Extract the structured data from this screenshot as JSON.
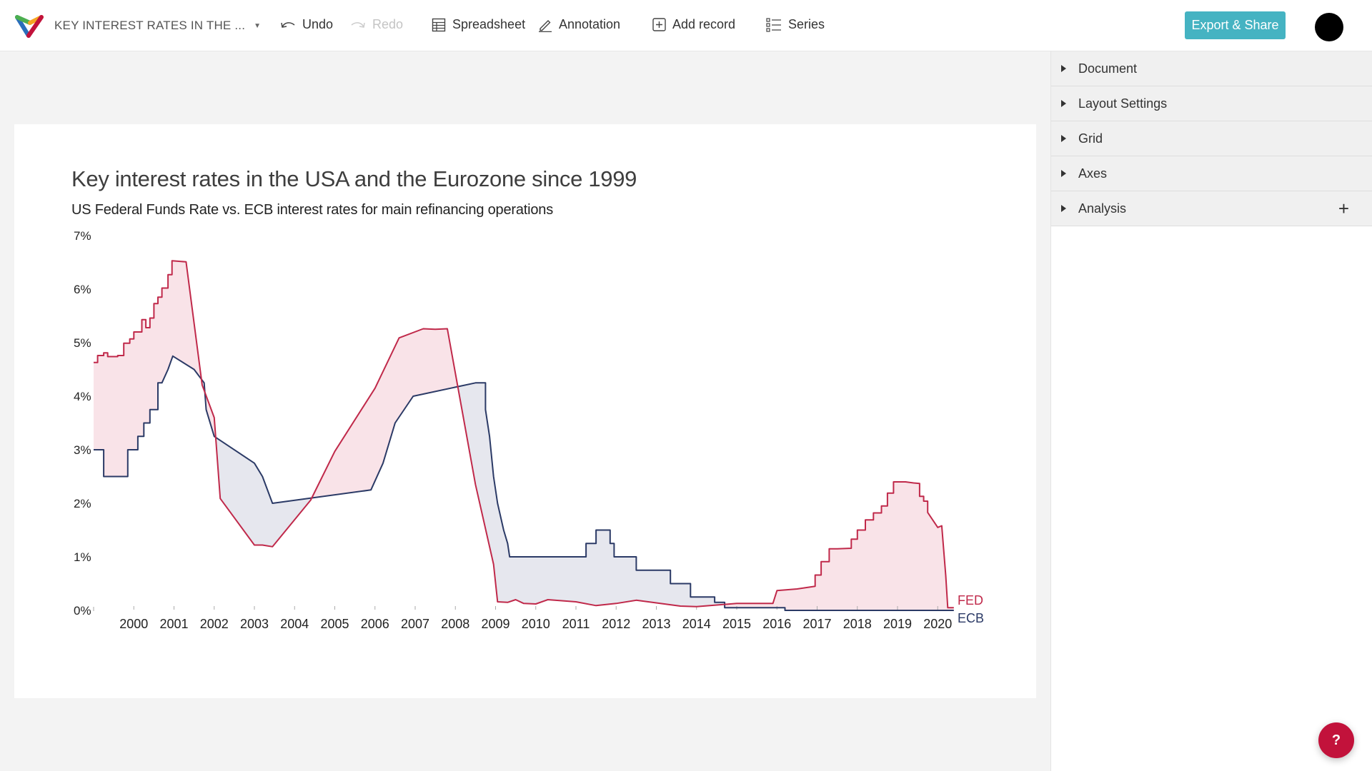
{
  "app": {
    "doc_title": "KEY INTEREST RATES IN THE ...",
    "toolbar": {
      "undo": "Undo",
      "redo": "Redo",
      "spreadsheet": "Spreadsheet",
      "annotation": "Annotation",
      "add_record": "Add record",
      "series": "Series",
      "export": "Export & Share"
    },
    "brand_color": "#45b3c2",
    "help_label": "?"
  },
  "sidebar": {
    "panels": [
      {
        "label": "Document"
      },
      {
        "label": "Layout Settings"
      },
      {
        "label": "Grid"
      },
      {
        "label": "Axes"
      },
      {
        "label": "Analysis",
        "has_add": true
      }
    ],
    "add_symbol": "+"
  },
  "chart_data": {
    "type": "area",
    "title": "Key interest rates in the USA and the Eurozone since 1999",
    "subtitle": "US Federal Funds Rate vs. ECB interest rates for main refinancing operations",
    "xlabel": "",
    "ylabel": "",
    "xlim": [
      1999,
      2020.4
    ],
    "ylim": [
      0,
      7
    ],
    "x_ticks": [
      "2000",
      "2001",
      "2002",
      "2003",
      "2004",
      "2005",
      "2006",
      "2007",
      "2008",
      "2009",
      "2010",
      "2011",
      "2012",
      "2013",
      "2014",
      "2015",
      "2016",
      "2017",
      "2018",
      "2019",
      "2020"
    ],
    "y_ticks": [
      "0%",
      "1%",
      "2%",
      "3%",
      "4%",
      "5%",
      "6%",
      "7%"
    ],
    "grid": false,
    "fill_between": true,
    "series": [
      {
        "name": "FED",
        "color": "#c0294a",
        "fill": "#f9e3e8",
        "points": [
          [
            1999.0,
            4.63
          ],
          [
            1999.1,
            4.63
          ],
          [
            1999.1,
            4.76
          ],
          [
            1999.25,
            4.76
          ],
          [
            1999.25,
            4.81
          ],
          [
            1999.35,
            4.81
          ],
          [
            1999.35,
            4.74
          ],
          [
            1999.6,
            4.74
          ],
          [
            1999.6,
            4.76
          ],
          [
            1999.75,
            4.76
          ],
          [
            1999.75,
            4.99
          ],
          [
            1999.9,
            4.99
          ],
          [
            1999.9,
            5.07
          ],
          [
            2000.0,
            5.07
          ],
          [
            2000.0,
            5.2
          ],
          [
            2000.2,
            5.2
          ],
          [
            2000.2,
            5.43
          ],
          [
            2000.3,
            5.43
          ],
          [
            2000.3,
            5.28
          ],
          [
            2000.4,
            5.28
          ],
          [
            2000.4,
            5.46
          ],
          [
            2000.5,
            5.46
          ],
          [
            2000.5,
            5.73
          ],
          [
            2000.6,
            5.73
          ],
          [
            2000.6,
            5.85
          ],
          [
            2000.7,
            5.85
          ],
          [
            2000.7,
            6.02
          ],
          [
            2000.85,
            6.02
          ],
          [
            2000.85,
            6.27
          ],
          [
            2000.95,
            6.27
          ],
          [
            2000.95,
            6.53
          ],
          [
            2001.3,
            6.51
          ],
          [
            2001.7,
            4.21
          ],
          [
            2002.0,
            3.6
          ],
          [
            2002.15,
            2.09
          ],
          [
            2003.0,
            1.22
          ],
          [
            2003.2,
            1.22
          ],
          [
            2003.45,
            1.19
          ],
          [
            2004.4,
            2.06
          ],
          [
            2005.0,
            2.97
          ],
          [
            2006.0,
            4.15
          ],
          [
            2006.6,
            5.09
          ],
          [
            2007.2,
            5.26
          ],
          [
            2007.5,
            5.25
          ],
          [
            2007.8,
            5.26
          ],
          [
            2008.5,
            2.35
          ],
          [
            2008.95,
            0.86
          ],
          [
            2009.05,
            0.16
          ],
          [
            2009.3,
            0.15
          ],
          [
            2009.5,
            0.2
          ],
          [
            2009.7,
            0.13
          ],
          [
            2010.0,
            0.12
          ],
          [
            2010.3,
            0.2
          ],
          [
            2011.0,
            0.16
          ],
          [
            2011.5,
            0.09
          ],
          [
            2012.0,
            0.13
          ],
          [
            2012.5,
            0.19
          ],
          [
            2013.0,
            0.14
          ],
          [
            2013.6,
            0.08
          ],
          [
            2014.0,
            0.07
          ],
          [
            2014.5,
            0.1
          ],
          [
            2015.0,
            0.13
          ],
          [
            2015.9,
            0.13
          ],
          [
            2016.0,
            0.37
          ],
          [
            2016.5,
            0.4
          ],
          [
            2016.95,
            0.45
          ],
          [
            2016.95,
            0.66
          ],
          [
            2017.1,
            0.66
          ],
          [
            2017.1,
            0.91
          ],
          [
            2017.3,
            0.91
          ],
          [
            2017.3,
            1.15
          ],
          [
            2017.5,
            1.15
          ],
          [
            2017.85,
            1.16
          ],
          [
            2017.85,
            1.33
          ],
          [
            2018.0,
            1.33
          ],
          [
            2018.0,
            1.5
          ],
          [
            2018.2,
            1.5
          ],
          [
            2018.2,
            1.69
          ],
          [
            2018.4,
            1.69
          ],
          [
            2018.4,
            1.82
          ],
          [
            2018.6,
            1.82
          ],
          [
            2018.6,
            1.95
          ],
          [
            2018.75,
            1.95
          ],
          [
            2018.75,
            2.19
          ],
          [
            2018.9,
            2.19
          ],
          [
            2018.9,
            2.4
          ],
          [
            2019.2,
            2.4
          ],
          [
            2019.4,
            2.38
          ],
          [
            2019.55,
            2.37
          ],
          [
            2019.55,
            2.13
          ],
          [
            2019.65,
            2.13
          ],
          [
            2019.65,
            2.04
          ],
          [
            2019.75,
            2.04
          ],
          [
            2019.75,
            1.83
          ],
          [
            2020.0,
            1.55
          ],
          [
            2020.1,
            1.58
          ],
          [
            2020.2,
            0.65
          ],
          [
            2020.25,
            0.05
          ],
          [
            2020.4,
            0.05
          ]
        ]
      },
      {
        "name": "ECB",
        "color": "#2b3a66",
        "fill": "#e6e7ee",
        "points": [
          [
            1999.0,
            3.0
          ],
          [
            1999.25,
            3.0
          ],
          [
            1999.25,
            2.5
          ],
          [
            1999.85,
            2.5
          ],
          [
            1999.85,
            3.0
          ],
          [
            2000.1,
            3.0
          ],
          [
            2000.1,
            3.25
          ],
          [
            2000.25,
            3.25
          ],
          [
            2000.25,
            3.5
          ],
          [
            2000.4,
            3.5
          ],
          [
            2000.4,
            3.75
          ],
          [
            2000.6,
            3.75
          ],
          [
            2000.6,
            4.25
          ],
          [
            2000.7,
            4.25
          ],
          [
            2000.85,
            4.5
          ],
          [
            2000.97,
            4.75
          ],
          [
            2001.5,
            4.5
          ],
          [
            2001.75,
            4.25
          ],
          [
            2001.8,
            3.75
          ],
          [
            2002.0,
            3.25
          ],
          [
            2003.0,
            2.75
          ],
          [
            2003.2,
            2.5
          ],
          [
            2003.45,
            2.0
          ],
          [
            2005.9,
            2.25
          ],
          [
            2006.2,
            2.75
          ],
          [
            2006.5,
            3.5
          ],
          [
            2006.95,
            4.0
          ],
          [
            2008.5,
            4.25
          ],
          [
            2008.75,
            4.25
          ],
          [
            2008.75,
            3.75
          ],
          [
            2008.85,
            3.25
          ],
          [
            2008.95,
            2.5
          ],
          [
            2009.05,
            2.0
          ],
          [
            2009.2,
            1.5
          ],
          [
            2009.3,
            1.25
          ],
          [
            2009.35,
            1.0
          ],
          [
            2011.25,
            1.0
          ],
          [
            2011.25,
            1.25
          ],
          [
            2011.5,
            1.25
          ],
          [
            2011.5,
            1.5
          ],
          [
            2011.85,
            1.5
          ],
          [
            2011.85,
            1.25
          ],
          [
            2011.95,
            1.25
          ],
          [
            2011.95,
            1.0
          ],
          [
            2012.5,
            1.0
          ],
          [
            2012.5,
            0.75
          ],
          [
            2013.35,
            0.75
          ],
          [
            2013.35,
            0.5
          ],
          [
            2013.85,
            0.5
          ],
          [
            2013.85,
            0.25
          ],
          [
            2014.45,
            0.25
          ],
          [
            2014.45,
            0.15
          ],
          [
            2014.7,
            0.15
          ],
          [
            2014.7,
            0.05
          ],
          [
            2016.2,
            0.05
          ],
          [
            2016.2,
            0.0
          ],
          [
            2020.4,
            0.0
          ]
        ]
      }
    ],
    "legend": [
      {
        "label": "FED",
        "color": "#c0294a",
        "position": "end-of-line"
      },
      {
        "label": "ECB",
        "color": "#2b3a66",
        "position": "end-of-line"
      }
    ]
  }
}
